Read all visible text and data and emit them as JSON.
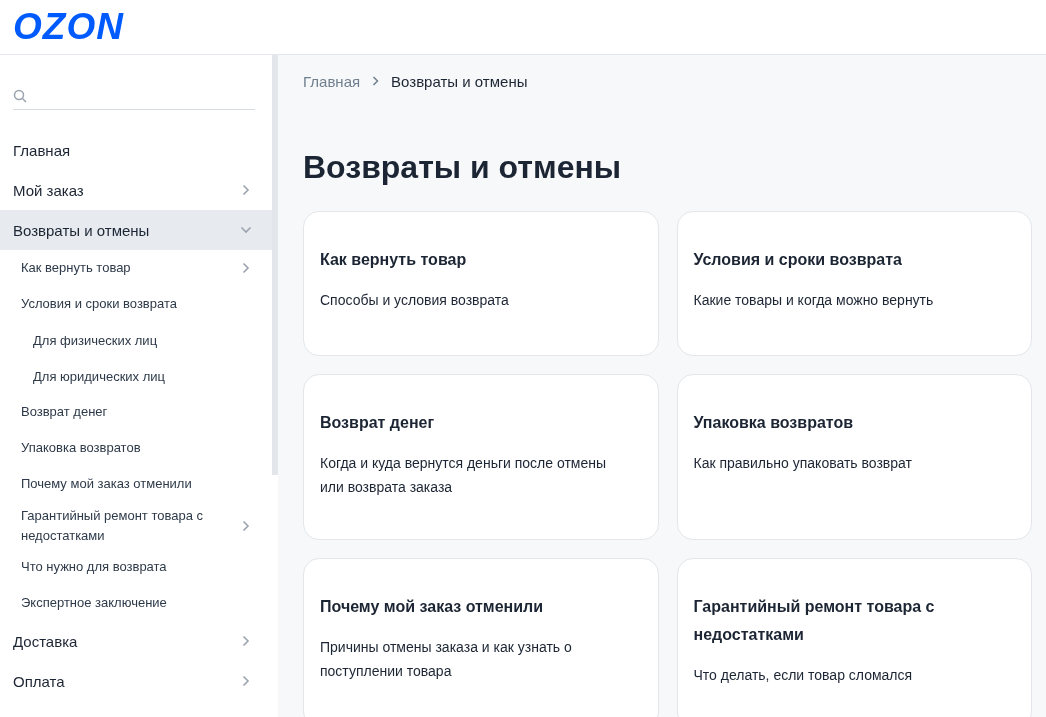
{
  "header": {
    "logo": "OZON"
  },
  "sidebar": {
    "items": [
      {
        "label": "Главная",
        "selected": false,
        "expandable": false
      },
      {
        "label": "Мой заказ",
        "selected": false,
        "expandable": true,
        "expanded": false
      },
      {
        "label": "Возвраты и отмены",
        "selected": true,
        "expandable": true,
        "expanded": true,
        "children": [
          {
            "label": "Как вернуть товар",
            "expandable": true,
            "expanded": false
          },
          {
            "label": "Условия и сроки возврата",
            "expandable": false,
            "children": [
              {
                "label": "Для физических лиц",
                "expandable": false
              },
              {
                "label": "Для юридических лиц",
                "expandable": false
              }
            ]
          },
          {
            "label": "Возврат денег",
            "expandable": false
          },
          {
            "label": "Упаковка возвратов",
            "expandable": false
          },
          {
            "label": "Почему мой заказ отменили",
            "expandable": false
          },
          {
            "label": "Гарантийный ремонт товара с недостатками",
            "expandable": true,
            "expanded": false
          },
          {
            "label": "Что нужно для возврата",
            "expandable": false
          },
          {
            "label": "Экспертное заключение",
            "expandable": false
          }
        ]
      },
      {
        "label": "Доставка",
        "selected": false,
        "expandable": true,
        "expanded": false
      },
      {
        "label": "Оплата",
        "selected": false,
        "expandable": true,
        "expanded": false
      }
    ]
  },
  "breadcrumbs": [
    "Главная",
    "Возвраты и отмены"
  ],
  "title": "Возвраты и отмены",
  "cards": [
    {
      "title": "Как вернуть товар",
      "description": "Способы и условия возврата"
    },
    {
      "title": "Условия и сроки возврата",
      "description": "Какие товары и когда можно вернуть"
    },
    {
      "title": "Возврат денег",
      "description": "Когда и куда вернутся деньги после отмены или возврата заказа"
    },
    {
      "title": "Упаковка возвратов",
      "description": "Как правильно упаковать возврат"
    },
    {
      "title": "Почему мой заказ отменили",
      "description": "Причины отмены заказа и как узнать о поступлении товара"
    },
    {
      "title": "Гарантийный ремонт товара с недостатками",
      "description": "Что делать, если товар сломался"
    }
  ]
}
